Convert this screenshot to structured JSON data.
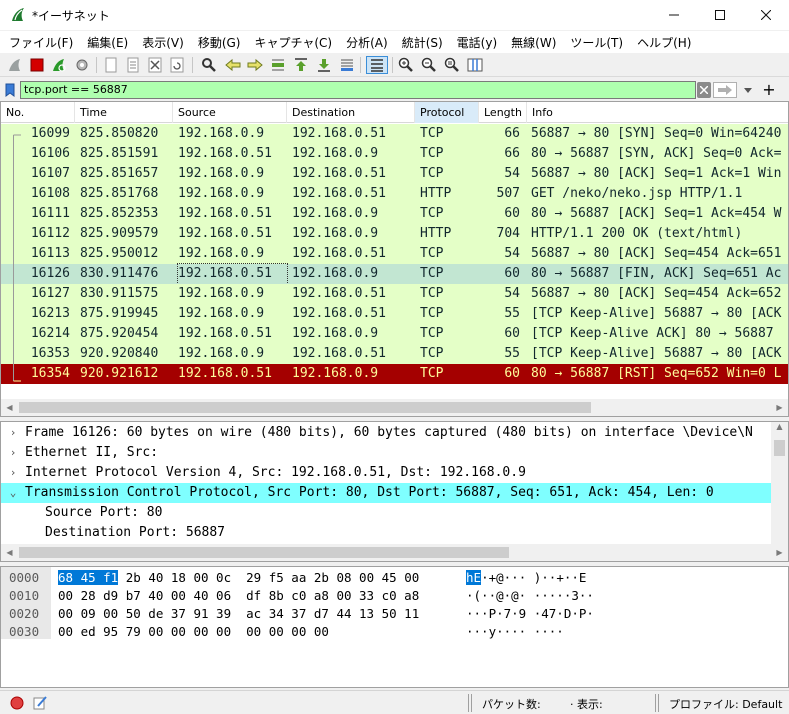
{
  "window": {
    "title": "*イーサネット"
  },
  "menu": [
    "ファイル(F)",
    "編集(E)",
    "表示(V)",
    "移動(G)",
    "キャプチャ(C)",
    "分析(A)",
    "統計(S)",
    "電話(y)",
    "無線(W)",
    "ツール(T)",
    "ヘルプ(H)"
  ],
  "filter": {
    "value": "tcp.port == 56887"
  },
  "columns": [
    "No.",
    "Time",
    "Source",
    "Destination",
    "Protocol",
    "Length",
    "Info"
  ],
  "packets": [
    {
      "no": "16099",
      "time": "825.850820",
      "src": "192.168.0.9",
      "dst": "192.168.0.51",
      "proto": "TCP",
      "len": "66",
      "info": "56887 → 80 [SYN] Seq=0 Win=64240"
    },
    {
      "no": "16106",
      "time": "825.851591",
      "src": "192.168.0.51",
      "dst": "192.168.0.9",
      "proto": "TCP",
      "len": "66",
      "info": "80 → 56887 [SYN, ACK] Seq=0 Ack="
    },
    {
      "no": "16107",
      "time": "825.851657",
      "src": "192.168.0.9",
      "dst": "192.168.0.51",
      "proto": "TCP",
      "len": "54",
      "info": "56887 → 80 [ACK] Seq=1 Ack=1 Win"
    },
    {
      "no": "16108",
      "time": "825.851768",
      "src": "192.168.0.9",
      "dst": "192.168.0.51",
      "proto": "HTTP",
      "len": "507",
      "info": "GET /neko/neko.jsp HTTP/1.1"
    },
    {
      "no": "16111",
      "time": "825.852353",
      "src": "192.168.0.51",
      "dst": "192.168.0.9",
      "proto": "TCP",
      "len": "60",
      "info": "80 → 56887 [ACK] Seq=1 Ack=454 W"
    },
    {
      "no": "16112",
      "time": "825.909579",
      "src": "192.168.0.51",
      "dst": "192.168.0.9",
      "proto": "HTTP",
      "len": "704",
      "info": "HTTP/1.1 200 OK  (text/html)"
    },
    {
      "no": "16113",
      "time": "825.950012",
      "src": "192.168.0.9",
      "dst": "192.168.0.51",
      "proto": "TCP",
      "len": "54",
      "info": "56887 → 80 [ACK] Seq=454 Ack=651"
    },
    {
      "no": "16126",
      "time": "830.911476",
      "src": "192.168.0.51",
      "dst": "192.168.0.9",
      "proto": "TCP",
      "len": "60",
      "info": "80 → 56887 [FIN, ACK] Seq=651 Ac"
    },
    {
      "no": "16127",
      "time": "830.911575",
      "src": "192.168.0.9",
      "dst": "192.168.0.51",
      "proto": "TCP",
      "len": "54",
      "info": "56887 → 80 [ACK] Seq=454 Ack=652"
    },
    {
      "no": "16213",
      "time": "875.919945",
      "src": "192.168.0.9",
      "dst": "192.168.0.51",
      "proto": "TCP",
      "len": "55",
      "info": "[TCP Keep-Alive] 56887 → 80 [ACK"
    },
    {
      "no": "16214",
      "time": "875.920454",
      "src": "192.168.0.51",
      "dst": "192.168.0.9",
      "proto": "TCP",
      "len": "60",
      "info": "[TCP Keep-Alive ACK] 80 → 56887"
    },
    {
      "no": "16353",
      "time": "920.920840",
      "src": "192.168.0.9",
      "dst": "192.168.0.51",
      "proto": "TCP",
      "len": "55",
      "info": "[TCP Keep-Alive] 56887 → 80 [ACK"
    },
    {
      "no": "16354",
      "time": "920.921612",
      "src": "192.168.0.51",
      "dst": "192.168.0.9",
      "proto": "TCP",
      "len": "60",
      "info": "80 → 56887 [RST] Seq=652 Win=0 L"
    }
  ],
  "details": [
    {
      "expanded": false,
      "text": "Frame 16126: 60 bytes on wire (480 bits), 60 bytes captured (480 bits) on interface \\Device\\N"
    },
    {
      "expanded": false,
      "text": "Ethernet II, Src:"
    },
    {
      "expanded": false,
      "text": "Internet Protocol Version 4, Src: 192.168.0.51, Dst: 192.168.0.9"
    },
    {
      "expanded": true,
      "text": "Transmission Control Protocol, Src Port: 80, Dst Port: 56887, Seq: 651, Ack: 454, Len: 0"
    },
    {
      "child": true,
      "text": "Source Port: 80"
    },
    {
      "child": true,
      "text": "Destination Port: 56887"
    }
  ],
  "bytes": {
    "offsets": [
      "0000",
      "0010",
      "0020",
      "0030"
    ],
    "hex_selected": "68 45 f1",
    "hex_rest": [
      " 2b 40 18 00 0c  29 f5 aa 2b 08 00 45 00",
      "00 28 d9 b7 40 00 40 06  df 8b c0 a8 00 33 c0 a8",
      "00 09 00 50 de 37 91 39  ac 34 37 d7 44 13 50 11",
      "00 ed 95 79 00 00 00 00  00 00 00 00"
    ],
    "ascii_selected": "hE",
    "ascii_rest": [
      "·+@··· )··+··E",
      "·(··@·@· ·····3··",
      "···P·7·9 ·47·D·P·",
      "···y···· ····"
    ]
  },
  "status": {
    "packets": "パケット数:",
    "displayed": "· 表示:",
    "profile": "プロファイル: Default"
  },
  "colors": {
    "row_bg": "#e4ffc7",
    "selected_bg": "#c2e6d2",
    "rst_bg": "#a40000",
    "rst_fg": "#fffc9c",
    "filter_bg": "#afffaf",
    "detail_hl": "#7fffff"
  }
}
